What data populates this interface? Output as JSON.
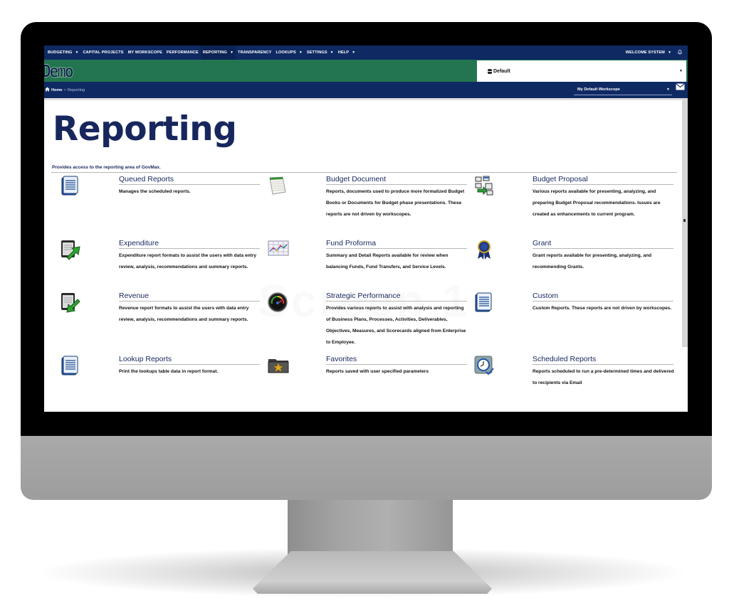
{
  "topnav": {
    "items": [
      {
        "label": "BUDGETING",
        "has_caret": true
      },
      {
        "label": "CAPITAL PROJECTS",
        "has_caret": false
      },
      {
        "label": "MY WORKSCOPE",
        "has_caret": false
      },
      {
        "label": "PERFORMANCE",
        "has_caret": false
      },
      {
        "label": "REPORTING",
        "has_caret": true,
        "active": true
      },
      {
        "label": "TRANSPARENCY",
        "has_caret": false
      },
      {
        "label": "LOOKUPS",
        "has_caret": true
      },
      {
        "label": "SETTINGS",
        "has_caret": true
      },
      {
        "label": "HELP",
        "has_caret": true
      }
    ],
    "caret_glyph": "▼",
    "welcome_label": "WELCOME SYSTEM",
    "bell_glyph": "♎"
  },
  "brand": {
    "logo_text": "Demo",
    "database_select_value": "Default",
    "caret_glyph": "▼"
  },
  "breadcrumb": {
    "home_glyph": "🏠",
    "home_label": "Home",
    "separator": ">",
    "current": "Reporting",
    "workscope_select_value": "My Default Workscope",
    "caret_glyph": "▼"
  },
  "page": {
    "title": "Reporting",
    "description": "Provides access to the reporting area of GovMax.",
    "watermark": "Screen 1"
  },
  "tiles": [
    {
      "title": "Queued Reports",
      "icon": "document-list-icon",
      "description": "Manages the scheduled reports."
    },
    {
      "title": "Budget Document",
      "icon": "notepad-icon",
      "description": "Reports, documents used to produce more formalized Budget Books or Documents for Budget phase presentations. These reports are not driven by workscopes."
    },
    {
      "title": "Budget Proposal",
      "icon": "proposal-network-icon",
      "description": "Various reports available for presenting, analyzing, and preparing Budget Proposal recommendations. Issues are created as enhancements to current program."
    },
    {
      "title": "Expenditure",
      "icon": "expenditure-arrow-out-icon",
      "description": "Expenditure report formats to assist the users with data entry review, analysis, recommendations and summary reports."
    },
    {
      "title": "Fund Proforma",
      "icon": "line-chart-grid-icon",
      "description": "Summary and Detail Reports available for review when balancing Funds, Fund Transfers, and Service Levels."
    },
    {
      "title": "Grant",
      "icon": "award-ribbon-icon",
      "description": "Grant reports available for presenting, analyzing, and recommending Grants."
    },
    {
      "title": "Revenue",
      "icon": "revenue-arrow-in-icon",
      "description": "Revenue report formats to assist the users with data entry review, analysis, recommendations and summary reports."
    },
    {
      "title": "Strategic Performance",
      "icon": "speedometer-icon",
      "description": "Provides various reports to assist with analysis and reporting of Business Plans, Processes, Activities, Deliverables, Objectives, Measures, and Scorecards aligned from Enterprise to Employee."
    },
    {
      "title": "Custom",
      "icon": "document-list-icon",
      "description": "Custom Reports. These reports are not driven by workscopes."
    },
    {
      "title": "Lookup Reports",
      "icon": "document-list-icon",
      "description": "Print the lookups table data in report format."
    },
    {
      "title": "Favorites",
      "icon": "star-folder-icon",
      "description": "Reports saved with user specified parameters"
    },
    {
      "title": "Scheduled Reports",
      "icon": "clock-check-icon",
      "description": "Reports scheduled to run a pre-determined times and delivered to recipients via Email"
    }
  ],
  "colors": {
    "nav_navy": "#0f2a63",
    "brand_green": "#237550",
    "title_navy": "#17275d"
  }
}
